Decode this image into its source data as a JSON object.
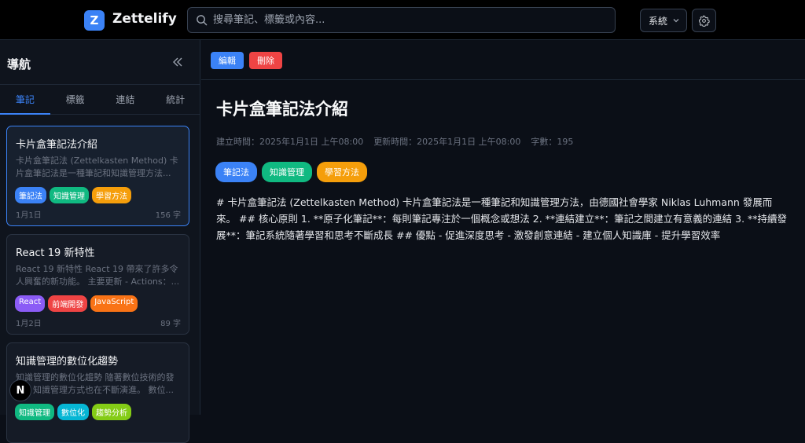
{
  "app": {
    "logo_letter": "Z",
    "title": "Zettelify"
  },
  "search": {
    "placeholder": "搜尋筆記、標籤或內容..."
  },
  "theme": {
    "selected": "系統"
  },
  "sidebar": {
    "title": "導航",
    "tabs": [
      {
        "label": "筆記"
      },
      {
        "label": "標籤"
      },
      {
        "label": "連結"
      },
      {
        "label": "統計"
      }
    ],
    "notes": [
      {
        "title": "卡片盒筆記法介紹",
        "excerpt": "卡片盒筆記法 (Zettelkasten Method) 卡片盒筆記法是一種筆記和知識管理方法...",
        "tags": [
          {
            "label": "筆記法",
            "color": "#3b82f6"
          },
          {
            "label": "知識管理",
            "color": "#10b981"
          },
          {
            "label": "學習方法",
            "color": "#f59e0b"
          }
        ],
        "date": "1月1日",
        "count": "156 字"
      },
      {
        "title": "React 19 新特性",
        "excerpt": "React 19 新特性 React 19 帶來了許多令人興奮的新功能。 主要更新 - Actions：...",
        "tags": [
          {
            "label": "React",
            "color": "#8b5cf6"
          },
          {
            "label": "前端開發",
            "color": "#ef4444"
          },
          {
            "label": "JavaScript",
            "color": "#f97316"
          }
        ],
        "date": "1月2日",
        "count": "89 字"
      },
      {
        "title": "知識管理的數位化趨勢",
        "excerpt": "知識管理的數位化趨勢 隨著數位技術的發展，知識管理方式也在不斷演進。 數位...",
        "tags": [
          {
            "label": "知識管理",
            "color": "#10b981"
          },
          {
            "label": "數位化",
            "color": "#06b6d4"
          },
          {
            "label": "趨勢分析",
            "color": "#84cc16"
          }
        ],
        "date": "",
        "count": ""
      }
    ]
  },
  "fab": {
    "label": "N"
  },
  "toolbar": {
    "edit_label": "編輯",
    "delete_label": "刪除"
  },
  "document": {
    "title": "卡片盒筆記法介紹",
    "created": "建立時間：2025年1月1日 上午08:00",
    "updated": "更新時間：2025年1月1日 上午08:00",
    "word_count": "字數：195",
    "tags": [
      {
        "label": "筆記法",
        "color": "#3b82f6"
      },
      {
        "label": "知識管理",
        "color": "#10b981"
      },
      {
        "label": "學習方法",
        "color": "#f59e0b"
      }
    ],
    "body": "# 卡片盒筆記法 (Zettelkasten Method) 卡片盒筆記法是一種筆記和知識管理方法，由德國社會學家 Niklas Luhmann 發展而來。 ## 核心原則 1. **原子化筆記**：每則筆記專注於一個概念或想法 2. **連結建立**：筆記之間建立有意義的連結 3. **持續發展**：筆記系統隨著學習和思考不斷成長 ## 優點 - 促進深度思考 - 激發創意連結 - 建立個人知識庫 - 提升學習效率"
  }
}
